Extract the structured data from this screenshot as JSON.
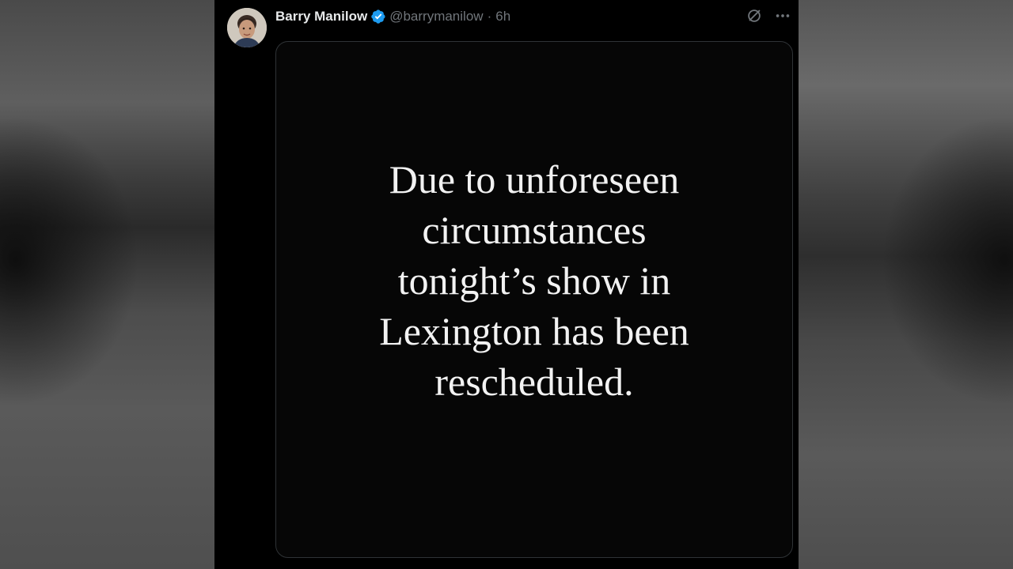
{
  "tweet": {
    "author": {
      "display_name": "Barry Manilow",
      "handle": "@barrymanilow",
      "verified": true,
      "avatar_icon": "profile-photo"
    },
    "separator": "·",
    "timestamp": "6h",
    "actions": {
      "grok_icon": "grok-icon",
      "more_icon": "more-horizontal-icon"
    },
    "media": {
      "lines": [
        "Due to unforeseen",
        "circumstances",
        "tonight’s show in",
        "Lexington has been",
        "rescheduled."
      ]
    }
  },
  "colors": {
    "background": "#000000",
    "text_primary": "#e7e9ea",
    "text_secondary": "#71767b",
    "verified_badge": "#1d9bf0",
    "border": "#2f3336"
  }
}
